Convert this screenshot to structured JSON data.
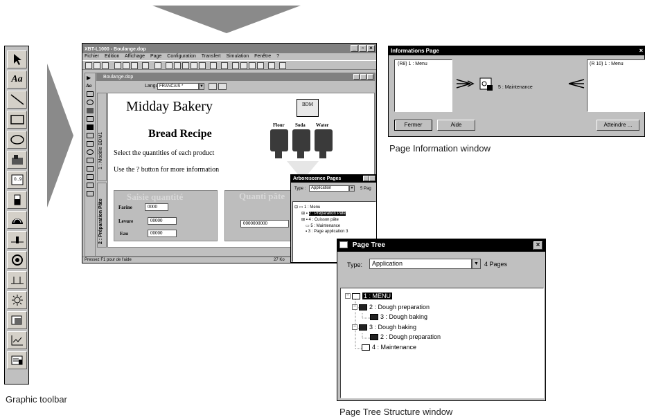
{
  "captions": {
    "graphic_toolbar": "Graphic toolbar",
    "page_info": "Page Information window",
    "page_tree": "Page Tree Structure window"
  },
  "app": {
    "title": "XBT-L1000 - Boulange.dop",
    "menu": [
      "Fichier",
      "Edition",
      "Affichage",
      "Page",
      "Configuration",
      "Transfert",
      "Simulation",
      "Fenêtre",
      "?"
    ],
    "doc_title": "Boulange.dop",
    "language_label": "Langue :",
    "language_value": "FRANCAIS *",
    "vertical_tab_1": "1 : Modèle BDM1",
    "vertical_tab_2": "2 : Préparation Pâte",
    "status_left": "Pressez F1 pour de l'aide",
    "status_right": "27 Ko",
    "canvas": {
      "heading": "Midday Bakery",
      "subheading": "Bread Recipe",
      "line1": "Select the quantities of each product",
      "line2": "Use the ? button for more information",
      "badge_text": "BDM",
      "tank_labels": [
        "Flour",
        "Soda",
        "Water"
      ],
      "saisie_title": "Saisie quantité",
      "quantite_title": "Quanti pâte",
      "fields": [
        {
          "label": "Farine",
          "value": "0000"
        },
        {
          "label": "Levure",
          "value": "00000"
        },
        {
          "label": "Eau",
          "value": "00000"
        }
      ],
      "quantite_value": "0000000000"
    }
  },
  "arbo": {
    "title": "Arborescence Pages",
    "type_label": "Type :",
    "type_value": "Application",
    "count": "5 Pag",
    "items": [
      "1 : Menu",
      "2 : Préparation Pâte",
      "4 : Cuisson pâte",
      "5 : Maintenance",
      "3 : Page application 3"
    ]
  },
  "info": {
    "title": "Informations Page",
    "left_box": "(R8) 1 : Menu",
    "right_box": "(R 10) 1 : Menu",
    "center_label": "5 : Maintenance",
    "btn_close": "Fermer",
    "btn_help": "Aide",
    "btn_goto": "Atteindre ..."
  },
  "tree": {
    "title": "Page Tree",
    "type_label": "Type:",
    "type_value": "Application",
    "count": "4 Pages",
    "items": [
      "1 : MENU",
      "2 : Dough preparation",
      "3 : Dough baking",
      "3 : Dough baking",
      "2 : Dough preparation",
      "4 : Maintenance"
    ]
  },
  "colors": {
    "arrow": "#8a8a8a",
    "title_active": "#000000",
    "window_face": "#c0c0c0"
  }
}
